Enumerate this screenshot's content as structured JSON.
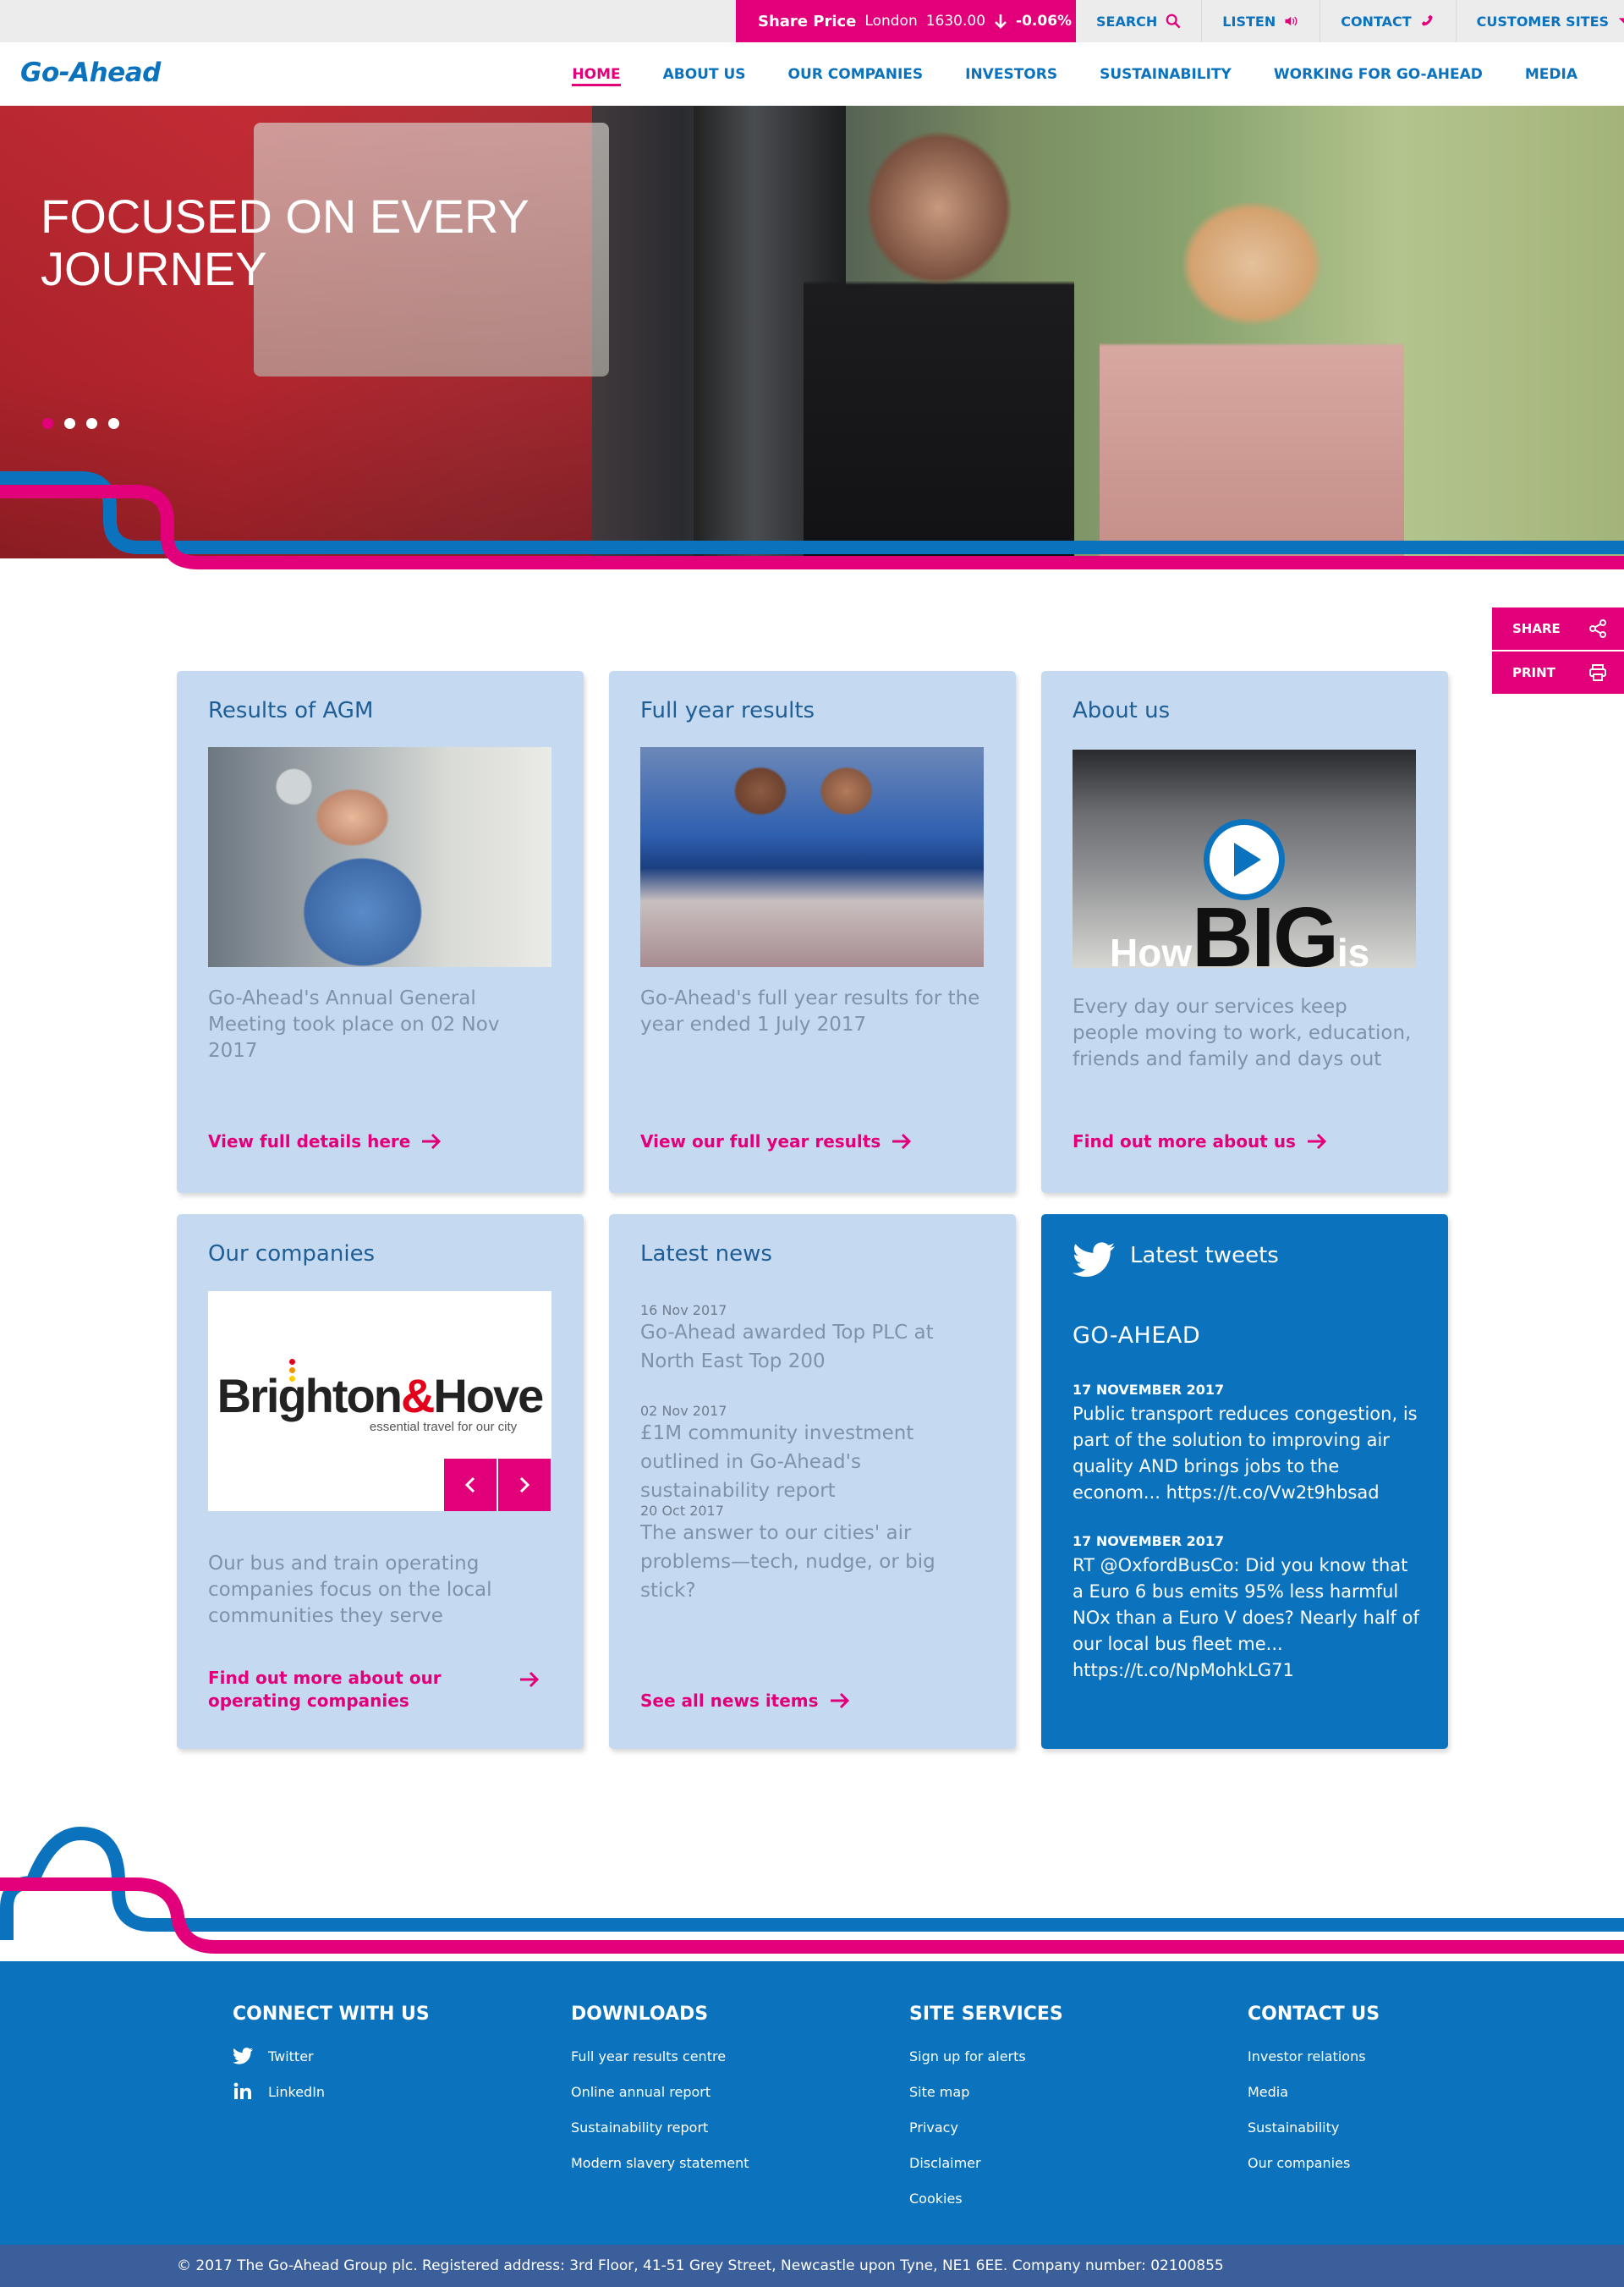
{
  "utility": {
    "share_price_label": "Share Price",
    "share_price_exchange": "London",
    "share_price_value": "1630.00",
    "share_price_change": "-0.06%",
    "links": [
      {
        "label": "SEARCH",
        "icon": "search-icon"
      },
      {
        "label": "LISTEN",
        "icon": "speaker-icon"
      },
      {
        "label": "CONTACT",
        "icon": "phone-icon"
      },
      {
        "label": "CUSTOMER SITES",
        "icon": "chevron-down-icon"
      }
    ]
  },
  "nav": {
    "logo": "Go-Ahead",
    "items": [
      {
        "label": "HOME"
      },
      {
        "label": "ABOUT US"
      },
      {
        "label": "OUR COMPANIES"
      },
      {
        "label": "INVESTORS"
      },
      {
        "label": "SUSTAINABILITY"
      },
      {
        "label": "WORKING FOR GO-AHEAD"
      },
      {
        "label": "MEDIA"
      }
    ]
  },
  "hero": {
    "title": "FOCUSED ON EVERY JOURNEY",
    "slide_count": 4,
    "active_slide": 1
  },
  "side_tools": {
    "share": "SHARE",
    "print": "PRINT"
  },
  "cards": {
    "agm": {
      "title": "Results of AGM",
      "text": "Go-Ahead's Annual General Meeting took place on 02 Nov 2017",
      "link": "View full details here"
    },
    "full_year": {
      "title": "Full year results",
      "text": "Go-Ahead's full year results for the year ended 1 July 2017",
      "link": "View our full year results"
    },
    "about": {
      "title": "About us",
      "video_text_how": "How",
      "video_text_big": "BIG",
      "video_text_is": "is",
      "text": "Every day our services keep people moving to work, education, friends and family and days out",
      "link": "Find out more about us"
    },
    "companies": {
      "title": "Our companies",
      "logo_main": "Brighton",
      "logo_amp": "&",
      "logo_end": "Hove",
      "logo_tagline": "essential travel for our city",
      "text": "Our bus and train operating companies focus on the local communities they serve",
      "link": "Find out more about our operating companies"
    },
    "news": {
      "title": "Latest news",
      "items": [
        {
          "date": "16 Nov 2017",
          "title": "Go-Ahead awarded Top PLC at North East Top 200"
        },
        {
          "date": "02 Nov 2017",
          "title": "£1M community investment outlined in Go-Ahead's sustainability report"
        },
        {
          "date": "20 Oct 2017",
          "title": "The answer to our cities' air problems—tech, nudge, or big stick?"
        }
      ],
      "link": "See all news items"
    },
    "tweets": {
      "title": "Latest tweets",
      "handle": "GO-AHEAD",
      "items": [
        {
          "date": "17 NOVEMBER 2017",
          "text": "Public transport reduces congestion, is part of the solution to improving air quality AND brings jobs to the econom... https://t.co/Vw2t9hbsad"
        },
        {
          "date": "17 NOVEMBER 2017",
          "text": "RT @OxfordBusCo: Did you know that a Euro 6 bus emits 95% less harmful NOx than a Euro V does? Nearly half of our local bus fleet me... https://t.co/NpMohkLG71"
        }
      ]
    }
  },
  "footer": {
    "connect": {
      "title": "CONNECT WITH US",
      "links": [
        "Twitter",
        "LinkedIn"
      ]
    },
    "downloads": {
      "title": "DOWNLOADS",
      "links": [
        "Full year results centre",
        "Online annual report",
        "Sustainability report",
        "Modern slavery statement"
      ]
    },
    "site_services": {
      "title": "SITE SERVICES",
      "links": [
        "Sign up for alerts",
        "Site map",
        "Privacy",
        "Disclaimer",
        "Cookies"
      ]
    },
    "contact": {
      "title": "CONTACT US",
      "links": [
        "Investor relations",
        "Media",
        "Sustainability",
        "Our companies"
      ]
    },
    "copyright": "© 2017 The Go-Ahead Group plc.  Registered address: 3rd Floor, 41-51 Grey Street, Newcastle upon Tyne, NE1 6EE.  Company number: 02100855"
  },
  "colors": {
    "brand_blue": "#0b72bd",
    "brand_pink": "#e2007a",
    "card_bg": "#c5daf1",
    "footer_bar": "#3a5f9a"
  }
}
